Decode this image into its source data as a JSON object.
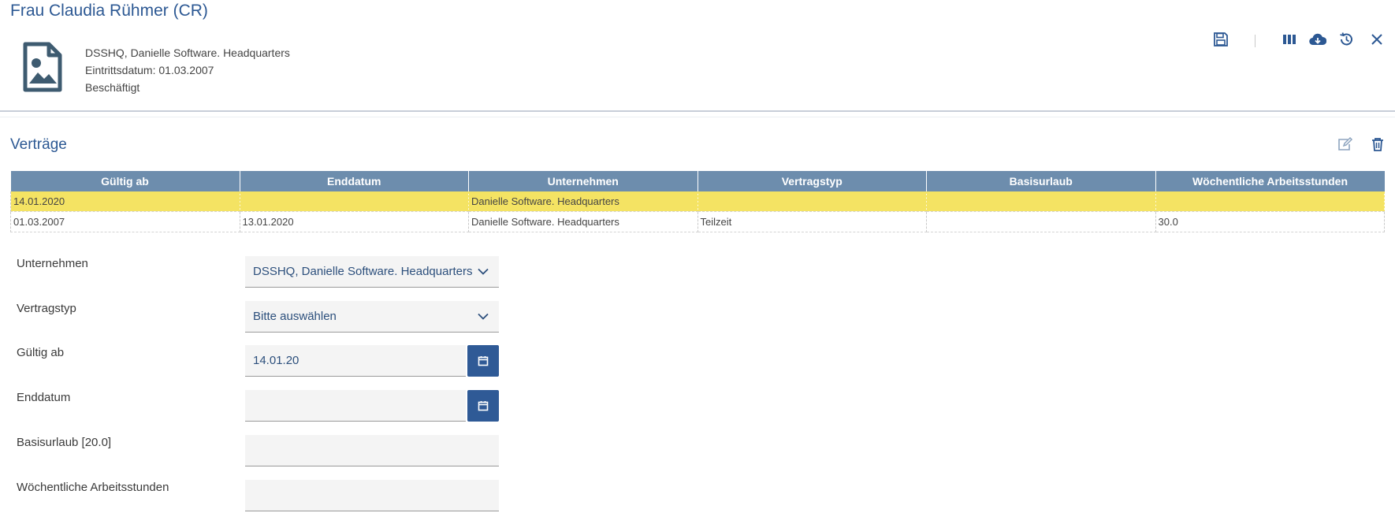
{
  "header": {
    "title": "Frau Claudia Rühmer (CR)",
    "meta_lines": [
      "DSSHQ, Danielle Software. Headquarters",
      "Eintrittsdatum: 01.03.2007",
      "Beschäftigt"
    ],
    "toolbar_icons": [
      "save-icon",
      "columns-icon",
      "cloud-download-icon",
      "history-icon",
      "close-icon"
    ]
  },
  "section": {
    "title": "Verträge",
    "icons": [
      "edit-icon",
      "trash-icon"
    ]
  },
  "table": {
    "columns": [
      "Gültig ab",
      "Enddatum",
      "Unternehmen",
      "Vertragstyp",
      "Basisurlaub",
      "Wöchentliche Arbeitsstunden"
    ],
    "rows": [
      [
        "14.01.2020",
        "",
        "Danielle Software. Headquarters",
        "",
        "",
        ""
      ],
      [
        "01.03.2007",
        "13.01.2020",
        "Danielle Software. Headquarters",
        "Teilzeit",
        "",
        "30.0"
      ]
    ],
    "selected_row": 0
  },
  "form": {
    "unternehmen": {
      "label": "Unternehmen",
      "value": "DSSHQ, Danielle Software. Headquarters"
    },
    "vertragstyp": {
      "label": "Vertragstyp",
      "value": "Bitte auswählen"
    },
    "gueltig_ab": {
      "label": "Gültig ab",
      "value": "14.01.20"
    },
    "enddatum": {
      "label": "Enddatum",
      "value": ""
    },
    "basisurlaub": {
      "label": "Basisurlaub [20.0]",
      "value": ""
    },
    "arbeitsstunden": {
      "label": "Wöchentliche Arbeitsstunden",
      "value": ""
    }
  },
  "colors": {
    "accent": "#2c5893",
    "table_header": "#6d8dad",
    "selected_row": "#f4e363",
    "calendar_button": "#2f5a96"
  }
}
